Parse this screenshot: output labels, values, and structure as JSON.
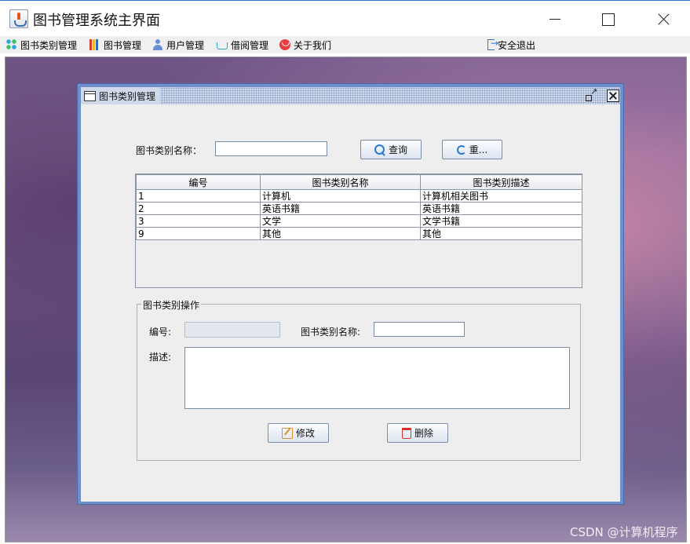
{
  "window": {
    "title": "图书管理系统主界面"
  },
  "menu": {
    "items": [
      {
        "label": "图书类别管理",
        "icon": "grid-icon"
      },
      {
        "label": "图书管理",
        "icon": "books-icon"
      },
      {
        "label": "用户管理",
        "icon": "user-icon"
      },
      {
        "label": "借阅管理",
        "icon": "cart-icon"
      },
      {
        "label": "关于我们",
        "icon": "about-icon"
      }
    ],
    "logout": {
      "label": "安全退出",
      "icon": "exit-icon"
    }
  },
  "frame": {
    "title": "图书类别管理"
  },
  "search": {
    "label": "图书类别名称：",
    "value": "",
    "query_button": "查询",
    "reset_button": "重..."
  },
  "table": {
    "columns": [
      "编号",
      "图书类别名称",
      "图书类别描述"
    ],
    "rows": [
      [
        "1",
        "计算机",
        "计算机相关图书"
      ],
      [
        "2",
        "英语书籍",
        "英语书籍"
      ],
      [
        "3",
        "文学",
        "文学书籍"
      ],
      [
        "9",
        "其他",
        "其他"
      ]
    ]
  },
  "operation": {
    "group_title": "图书类别操作",
    "id_label": "编号:",
    "id_value": "",
    "name_label": "图书类别名称:",
    "name_value": "",
    "desc_label": "描述:",
    "desc_value": "",
    "modify_button": "修改",
    "delete_button": "删除"
  },
  "watermark": "CSDN @计算机程序",
  "colors": {
    "accent": "#2a7ad4",
    "frame_border": "#6d8fcc",
    "delete_icon": "#d8322a",
    "edit_icon": "#e2902a"
  }
}
